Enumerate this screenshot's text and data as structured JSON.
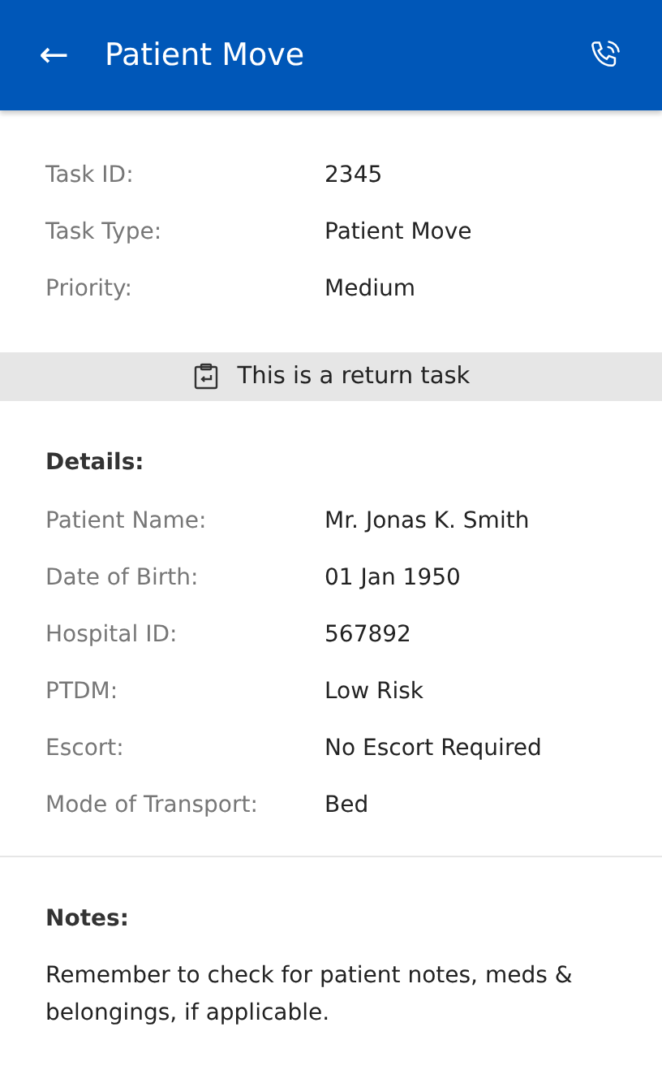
{
  "header": {
    "back": "←",
    "title": "Patient Move"
  },
  "task": [
    {
      "label": "Task ID:",
      "value": "2345"
    },
    {
      "label": "Task Type:",
      "value": "Patient Move"
    },
    {
      "label": "Priority:",
      "value": "Medium"
    }
  ],
  "banner": "This is a return task",
  "details": {
    "heading": "Details:",
    "rows": [
      {
        "label": "Patient Name:",
        "value": "Mr. Jonas K. Smith"
      },
      {
        "label": "Date of Birth:",
        "value": "01 Jan 1950"
      },
      {
        "label": "Hospital ID:",
        "value": "567892"
      },
      {
        "label": "PTDM:",
        "value": "Low Risk"
      },
      {
        "label": "Escort:",
        "value": "No Escort Required"
      },
      {
        "label": "Mode of Transport:",
        "value": "Bed"
      }
    ]
  },
  "notes": {
    "heading": "Notes:",
    "text": "Remember to check for patient notes, meds & belongings, if applicable."
  }
}
